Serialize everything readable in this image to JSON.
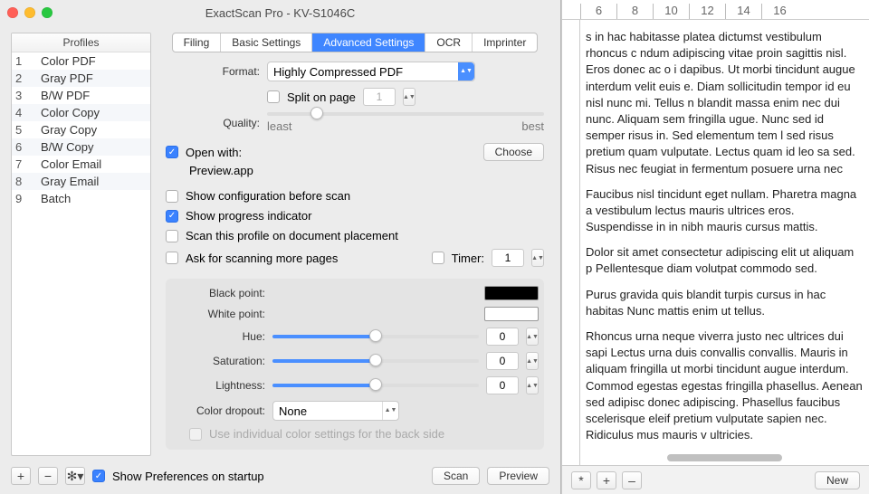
{
  "window": {
    "title": "ExactScan Pro - KV-S1046C"
  },
  "profiles": {
    "header": "Profiles",
    "items": [
      {
        "n": "1",
        "name": "Color PDF"
      },
      {
        "n": "2",
        "name": "Gray PDF"
      },
      {
        "n": "3",
        "name": "B/W PDF"
      },
      {
        "n": "4",
        "name": "Color Copy"
      },
      {
        "n": "5",
        "name": "Gray Copy"
      },
      {
        "n": "6",
        "name": "B/W Copy"
      },
      {
        "n": "7",
        "name": "Color Email"
      },
      {
        "n": "8",
        "name": "Gray Email"
      },
      {
        "n": "9",
        "name": "Batch"
      }
    ]
  },
  "tabs": [
    "Filing",
    "Basic Settings",
    "Advanced Settings",
    "OCR",
    "Imprinter"
  ],
  "form": {
    "format_label": "Format:",
    "format_value": "Highly Compressed PDF",
    "split_label": "Split on page",
    "split_value": "1",
    "quality_label": "Quality:",
    "quality_least": "least",
    "quality_best": "best",
    "open_with_label": "Open with:",
    "open_with_app": "Preview.app",
    "choose": "Choose",
    "show_config": "Show configuration before scan",
    "show_progress": "Show progress indicator",
    "scan_placement": "Scan this profile on document placement",
    "ask_more": "Ask for scanning more pages",
    "timer_label": "Timer:",
    "timer_value": "1",
    "black_point": "Black point:",
    "white_point": "White point:",
    "hue": "Hue:",
    "hue_val": "0",
    "saturation": "Saturation:",
    "sat_val": "0",
    "lightness": "Lightness:",
    "light_val": "0",
    "color_dropout": "Color dropout:",
    "color_dropout_value": "None",
    "individual": "Use individual color settings for the back side"
  },
  "bottom": {
    "show_prefs": "Show Preferences on startup",
    "scan": "Scan",
    "preview": "Preview"
  },
  "ruler_h": [
    "6",
    "8",
    "10",
    "12",
    "14",
    "16"
  ],
  "preview_text": {
    "p1": "s in hac habitasse platea dictumst vestibulum rhoncus c ndum adipiscing vitae proin sagittis nisl. Eros donec ac o i dapibus. Ut morbi tincidunt augue interdum velit euis e. Diam sollicitudin tempor id eu nisl nunc mi. Tellus n  blandit massa enim nec dui nunc. Aliquam sem fringilla ugue. Nunc sed id semper risus in. Sed elementum tem l sed risus pretium quam vulputate. Lectus quam id leo  sa sed. Risus nec feugiat in fermentum posuere urna nec",
    "p2": "Faucibus nisl tincidunt eget nullam. Pharetra magna a vestibulum lectus mauris ultrices eros. Suspendisse in  in nibh mauris cursus mattis.",
    "p3": "Dolor sit amet consectetur adipiscing elit ut aliquam p Pellentesque diam volutpat commodo sed.",
    "p4": "Purus gravida quis blandit turpis cursus in hac habitas Nunc mattis enim ut tellus.",
    "p5": "Rhoncus urna neque viverra justo nec ultrices dui sapi Lectus urna duis convallis convallis. Mauris in aliquam fringilla ut morbi tincidunt augue interdum. Commod egestas egestas fringilla phasellus. Aenean sed adipisc donec adipiscing. Phasellus faucibus scelerisque eleif pretium vulputate sapien nec. Ridiculus mus mauris v ultricies."
  },
  "preview_bottom": {
    "star": "*",
    "plus": "+",
    "minus": "–",
    "new": "New"
  }
}
